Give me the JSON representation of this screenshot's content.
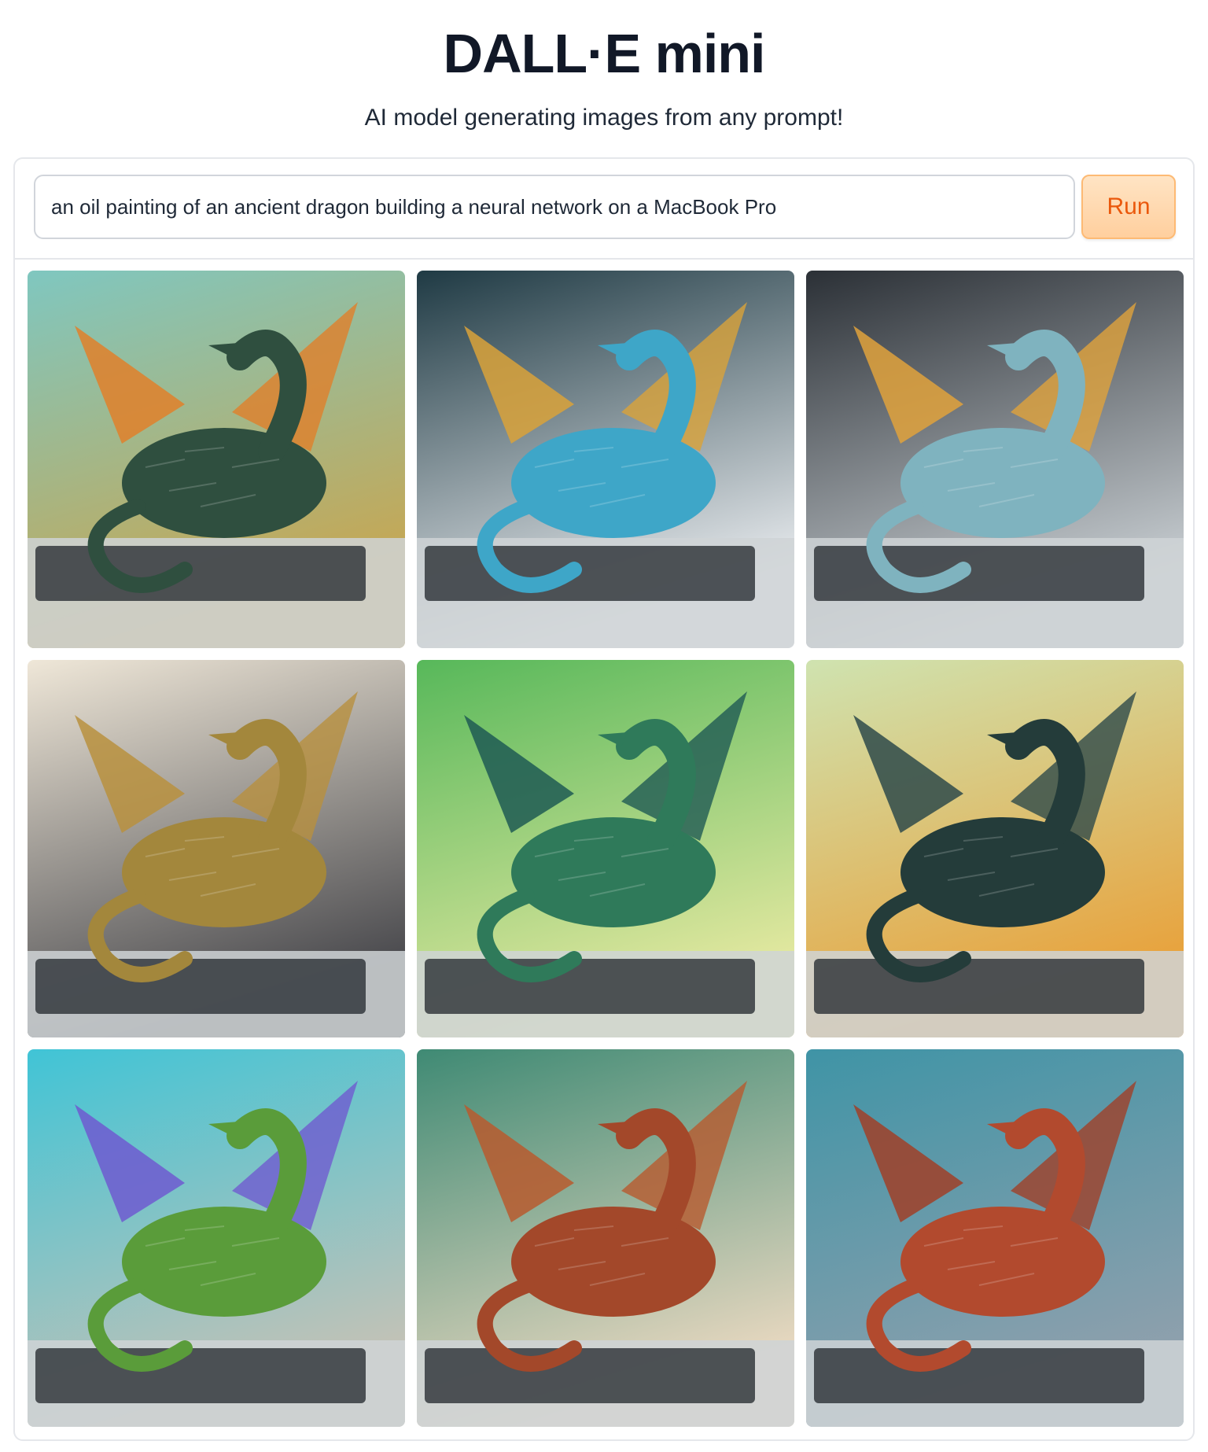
{
  "header": {
    "title": "DALL·E mini",
    "subtitle": "AI model generating images from any prompt!"
  },
  "prompt": {
    "value": "an oil painting of an ancient dragon building a neural network on a MacBook Pro",
    "placeholder": ""
  },
  "run_button": {
    "label": "Run"
  },
  "gallery": {
    "images": [
      {
        "name": "dragon-image-1",
        "dragon_color": "#2f4f3f",
        "bg_top": "#7fc7c0",
        "bg_bottom": "#c8a650",
        "wing_color": "#e0802a"
      },
      {
        "name": "dragon-image-2",
        "dragon_color": "#3ea6c8",
        "bg_top": "#1f3a44",
        "bg_bottom": "#e9ecef",
        "wing_color": "#d9a23a"
      },
      {
        "name": "dragon-image-3",
        "dragon_color": "#7fb3bf",
        "bg_top": "#2b3036",
        "bg_bottom": "#c9cfd3",
        "wing_color": "#e0a23c"
      },
      {
        "name": "dragon-image-4",
        "dragon_color": "#a3873c",
        "bg_top": "#efe7d8",
        "bg_bottom": "#4a4a4e",
        "wing_color": "#b8903e"
      },
      {
        "name": "dragon-image-5",
        "dragon_color": "#2f7a5a",
        "bg_top": "#57b85a",
        "bg_bottom": "#e3e8a0",
        "wing_color": "#1f5a54"
      },
      {
        "name": "dragon-image-6",
        "dragon_color": "#243c3a",
        "bg_top": "#cfe3b0",
        "bg_bottom": "#e8a23c",
        "wing_color": "#2e4a4a"
      },
      {
        "name": "dragon-image-7",
        "dragon_color": "#5a9c3a",
        "bg_top": "#40c4d6",
        "bg_bottom": "#c4c2b6",
        "wing_color": "#6f5bd0"
      },
      {
        "name": "dragon-image-8",
        "dragon_color": "#a3482a",
        "bg_top": "#3f8a74",
        "bg_bottom": "#e8d8c0",
        "wing_color": "#b85a2e"
      },
      {
        "name": "dragon-image-9",
        "dragon_color": "#b24a2e",
        "bg_top": "#3f94a6",
        "bg_bottom": "#8fa0ad",
        "wing_color": "#a04028"
      }
    ]
  }
}
